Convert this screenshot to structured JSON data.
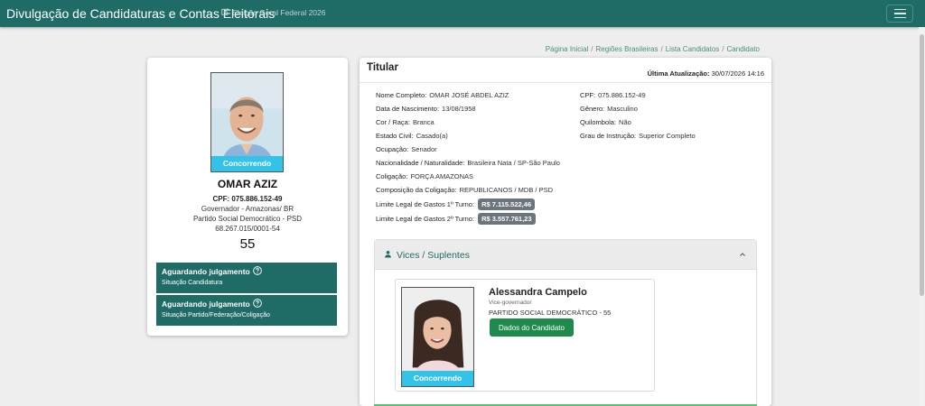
{
  "header": {
    "app_title": "Divulgação de Candidaturas e Contas Eleitorais",
    "election": "Eleição Geral Federal 2026",
    "menu_icon": "hamburger-icon"
  },
  "breadcrumb": {
    "items": [
      "Página Inicial",
      "Regiões Brasileiras",
      "Lista Candidatos",
      "Candidato"
    ],
    "separator": "/"
  },
  "candidate": {
    "photo_badge": "Concorrendo",
    "name": "OMAR AZIZ",
    "cpf_line": "CPF: 075.886.152-49",
    "office": "Governador - Amazonas/ BR",
    "party": "Partido Social Democrático - PSD",
    "cnpj": "68.267.015/0001-54",
    "number": "55",
    "status_candidacy": {
      "title": "Aguardando julgamento",
      "subtitle": "Situação Candidatura"
    },
    "status_party": {
      "title": "Aguardando julgamento",
      "subtitle": "Situação Partido/Federação/Coligação"
    }
  },
  "details": {
    "title": "Titular",
    "last_update_label": "Última Atualização:",
    "last_update_value": "30/07/2026 14:16",
    "full_name": {
      "label": "Nome Completo:",
      "value": "OMAR JOSÉ ABDEL AZIZ"
    },
    "cpf": {
      "label": "CPF:",
      "value": "075.886.152-49"
    },
    "birth_date": {
      "label": "Data de Nascimento:",
      "value": "13/08/1958"
    },
    "gender": {
      "label": "Gênero:",
      "value": "Masculino"
    },
    "race": {
      "label": "Cor / Raça:",
      "value": "Branca"
    },
    "quilombola": {
      "label": "Quilombola:",
      "value": "Não"
    },
    "marital": {
      "label": "Estado Civil:",
      "value": "Casado(a)"
    },
    "education": {
      "label": "Grau de Instrução:",
      "value": "Superior Completo"
    },
    "occupation": {
      "label": "Ocupação:",
      "value": "Senador"
    },
    "nationality": {
      "label": "Nacionalidade / Naturalidade:",
      "value": "Brasileira Nata / SP-São Paulo"
    },
    "coalition": {
      "label": "Coligação:",
      "value": "FORÇA AMAZONAS"
    },
    "coalition_composition": {
      "label": "Composição da Coligação:",
      "value": "REPUBLICANOS / MDB / PSD"
    },
    "limit_1": {
      "label": "Limite Legal de Gastos 1º Turno:",
      "value": "R$ 7.115.522,46"
    },
    "limit_2": {
      "label": "Limite Legal de Gastos 2º Turno:",
      "value": "R$ 3.557.761,23"
    }
  },
  "vices": {
    "title": "Vices / Suplentes",
    "card": {
      "photo_badge": "Concorrendo",
      "name": "Alessandra Campelo",
      "role": "Vice-governador",
      "party": "PARTIDO SOCIAL DEMOCRÁTICO - 55",
      "button": "Dados do Candidato"
    }
  },
  "colors": {
    "topbar": "#1f6b66",
    "status_box": "#1f6b66",
    "badge": "#34c3e8",
    "primary_button": "#1e8a4c",
    "money_badge": "#6c757d"
  }
}
